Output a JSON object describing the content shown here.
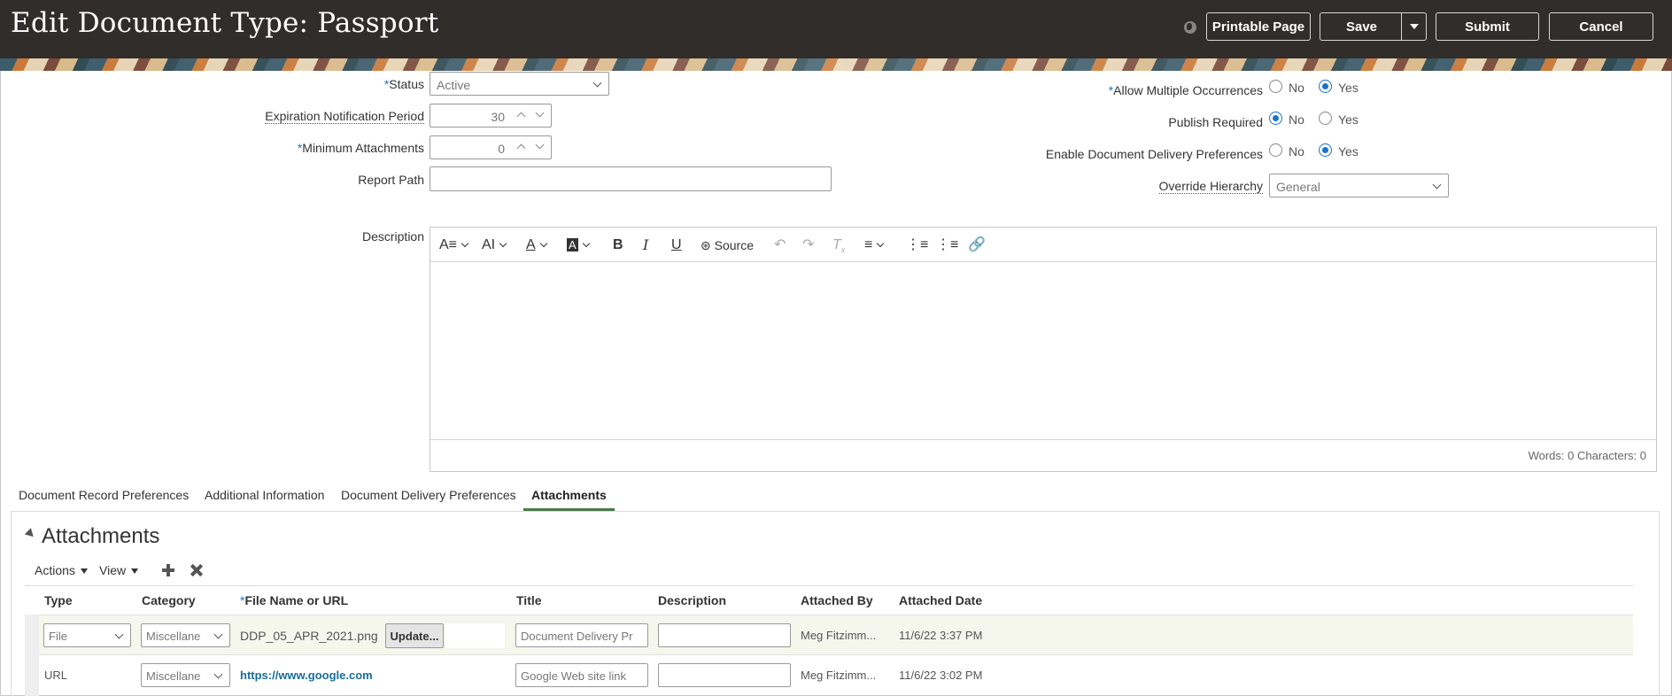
{
  "header": {
    "title": "Edit Document Type: Passport",
    "printable_label": "Printable Page",
    "save_label": "Save",
    "submit_label": "Submit",
    "cancel_label": "Cancel"
  },
  "form": {
    "status": {
      "label": "Status",
      "value": "Active"
    },
    "expiration": {
      "label": "Expiration Notification Period",
      "value": "30"
    },
    "min_attachments": {
      "label": "Minimum Attachments",
      "value": "0"
    },
    "report_path": {
      "label": "Report Path",
      "value": ""
    },
    "allow_multiple": {
      "label": "Allow Multiple Occurrences",
      "no": "No",
      "yes": "Yes",
      "selected": "Yes"
    },
    "publish_required": {
      "label": "Publish Required",
      "no": "No",
      "yes": "Yes",
      "selected": "No"
    },
    "enable_delivery": {
      "label": "Enable Document Delivery Preferences",
      "no": "No",
      "yes": "Yes",
      "selected": "Yes"
    },
    "override_hierarchy": {
      "label": "Override Hierarchy",
      "value": "General"
    },
    "description": {
      "label": "Description"
    }
  },
  "editor": {
    "source_label": "Source",
    "word_count": "Words: 0 Characters: 0"
  },
  "tabs": [
    {
      "label": "Document Record Preferences"
    },
    {
      "label": "Additional Information"
    },
    {
      "label": "Document Delivery Preferences"
    },
    {
      "label": "Attachments",
      "active": true
    }
  ],
  "attachments": {
    "title": "Attachments",
    "actions_label": "Actions",
    "view_label": "View",
    "columns": [
      "Type",
      "Category",
      "File Name or URL",
      "Title",
      "Description",
      "Attached By",
      "Attached Date"
    ],
    "rows": [
      {
        "type": "File",
        "category": "Miscellane",
        "file": "DDP_05_APR_2021.png",
        "update_label": "Update...",
        "title": "Document Delivery Pr",
        "description": "",
        "attached_by": "Meg Fitzimm...",
        "attached_date": "11/6/22 3:37 PM"
      },
      {
        "type": "URL",
        "category": "Miscellane",
        "file": "https://www.google.com",
        "title": "Google Web site link",
        "description": "",
        "attached_by": "Meg Fitzimm...",
        "attached_date": "11/6/22 3:02 PM"
      }
    ]
  },
  "colors": {
    "header_bg": "#312d2a",
    "accent_blue": "#1a73c5",
    "tab_active_underline": "#4a7a4a",
    "link": "#176e9a"
  }
}
